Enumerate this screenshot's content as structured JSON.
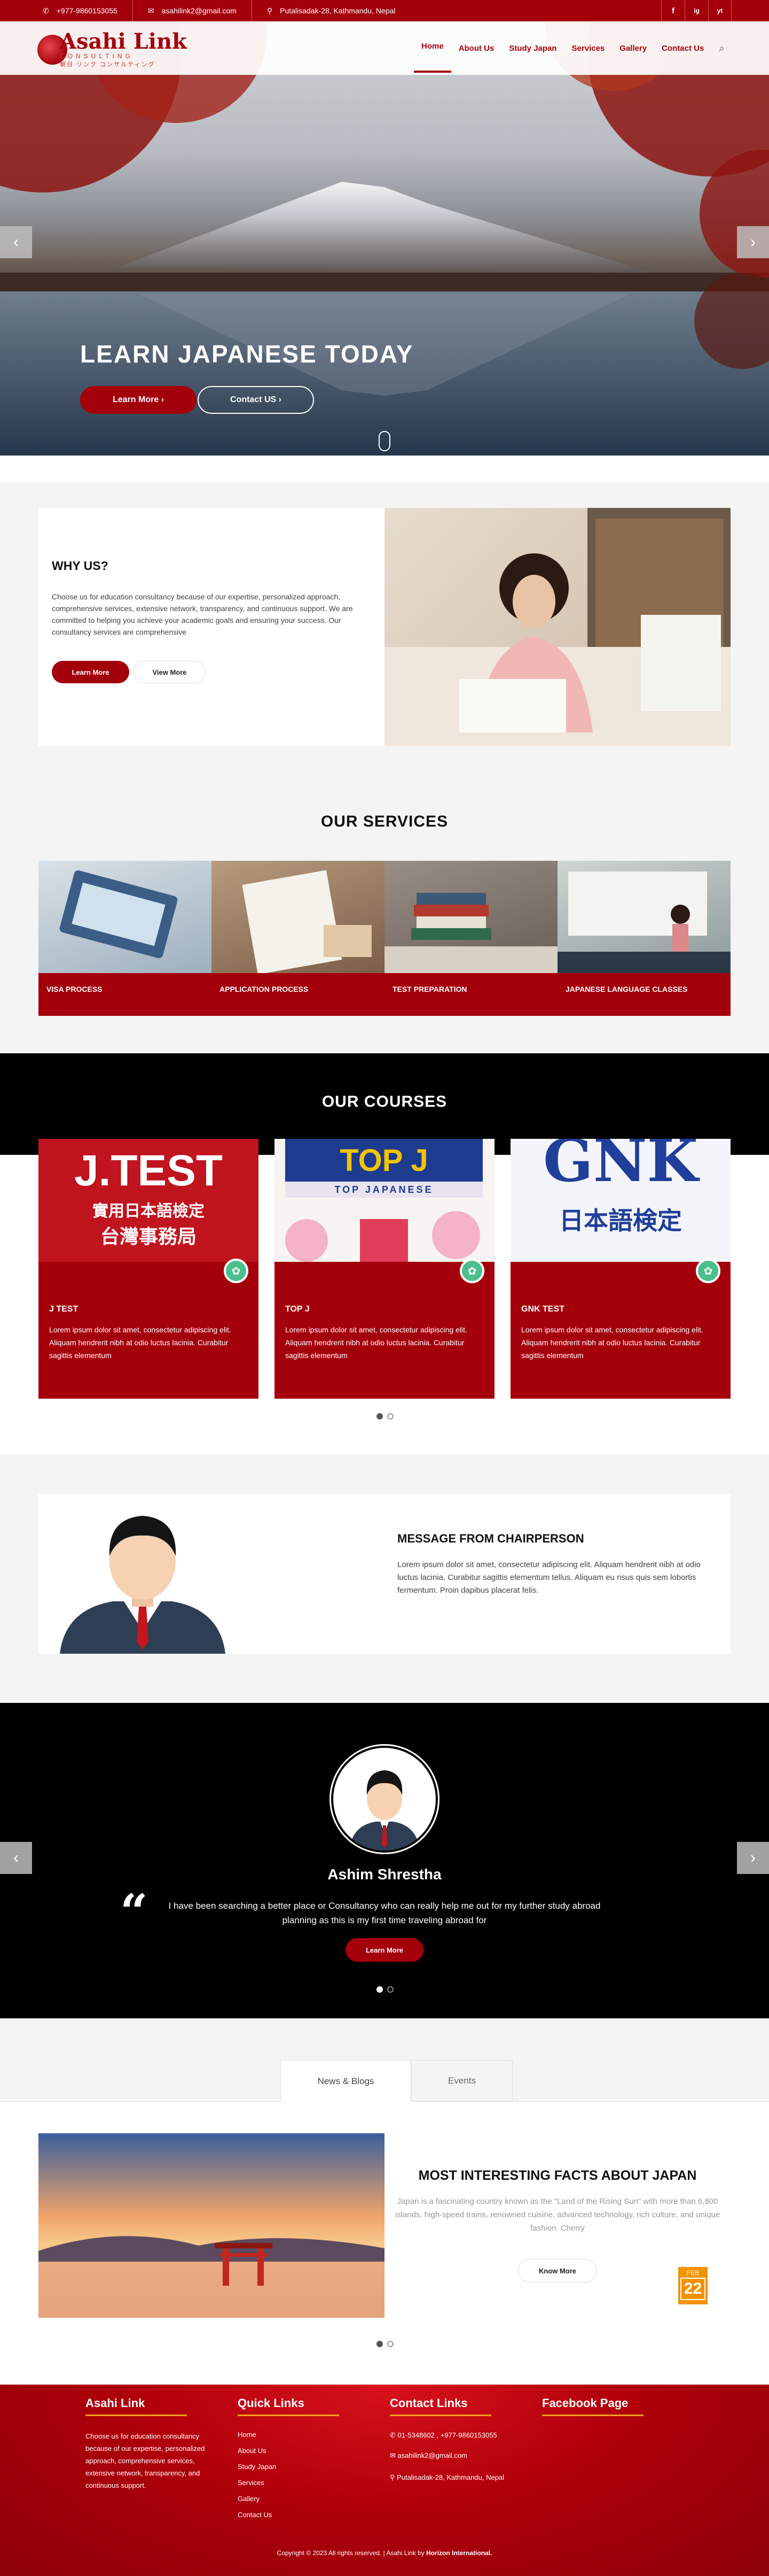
{
  "topbar": {
    "phone": "+977-9860153055",
    "email": "asahilink2@gmail.com",
    "address": "Putalisadak-28, Kathmandu, Nepal",
    "social": [
      "f",
      "ig",
      "yt"
    ]
  },
  "brand": {
    "name": "Asahi Link",
    "sub": "CONSULTING",
    "jp": "朝日 リンク コンサルティング"
  },
  "nav": [
    "Home",
    "About Us",
    "Study Japan",
    "Services",
    "Gallery",
    "Contact Us"
  ],
  "hero": {
    "title": "LEARN JAPANESE TODAY",
    "btn1": "Learn More ›",
    "btn2": "Contact US ›"
  },
  "why": {
    "title": "WHY US?",
    "text": "Choose us for education consultancy because of our expertise, personalized approach, comprehensive services, extensive network, transparency, and continuous support. We are committed to helping you achieve your academic goals and ensuring your success. Our consultancy services are comprehensive",
    "btn1": "Learn More",
    "btn2": "View More"
  },
  "services": {
    "title": "OUR SERVICES",
    "items": [
      "VISA PROCESS",
      "APPLICATION PROCESS",
      "TEST PREPARATION",
      "JAPANESE LANGUAGE CLASSES"
    ]
  },
  "courses": {
    "title": "OUR COURSES",
    "items": [
      {
        "name": "J TEST",
        "img": "J.TEST",
        "img2": "實用日本語檢定",
        "img3": "台灣事務局",
        "text": "Lorem ipsum dolor sit amet, consectetur adipiscing elit. Aliquam hendrerit nibh at odio luctus lacinia. Curabitur sagittis elementum"
      },
      {
        "name": "TOP J",
        "img": "TOP J",
        "img2": "TOP JAPANESE",
        "text": "Lorem ipsum dolor sit amet, consectetur adipiscing elit. Aliquam hendrerit nibh at odio luctus lacinia. Curabitur sagittis elementum"
      },
      {
        "name": "GNK TEST",
        "img": "GNK",
        "img2": "日本語検定",
        "text": "Lorem ipsum dolor sit amet, consectetur adipiscing elit. Aliquam hendrerit nibh at odio luctus lacinia. Curabitur sagittis elementum"
      }
    ]
  },
  "chair": {
    "title": "MESSAGE FROM CHAIRPERSON",
    "text": "Lorem ipsum dolor sit amet, consectetur adipiscing elit. Aliquam hendrerit nibh at odio luctus lacinia. Curabitur sagittis elementum tellus. Aliquam eu risus quis sem lobortis fermentum. Proin dapibus placerat felis."
  },
  "testimonial": {
    "name": "Ashim Shrestha",
    "quote": "I have been searching a better place or Consultancy who can really help me out for my further study abroad planning as this is my first time traveling abroad  for",
    "btn": "Learn More"
  },
  "news": {
    "tabs": [
      "News & Blogs",
      "Events"
    ],
    "title": "MOST INTERESTING FACTS ABOUT JAPAN",
    "text": "Japan is a fascinating country known as the \"Land of the Rising Sun\" with more than 6,800 islands, high-speed trains, renowned cuisine, advanced technology, rich culture, and unique fashion. Cherry",
    "btn": "Know More",
    "month": "FEB",
    "day": "22"
  },
  "footer": {
    "c1": {
      "title": "Asahi Link",
      "text": "Choose us for education consultancy because of our expertise, personalized approach, comprehensive services, extensive network, transparency, and continuous support."
    },
    "c2": {
      "title": "Quick Links",
      "links": [
        "Home",
        "About Us",
        "Study Japan",
        "Services",
        "Gallery",
        "Contact Us"
      ]
    },
    "c3": {
      "title": "Contact Links",
      "phone": "01-5348602 , +977-9860153055",
      "email": "asahilink2@gmail.com",
      "address": "Putalisadak-28, Kathmandu, Nepal"
    },
    "c4": {
      "title": "Facebook Page"
    },
    "copy": "Copyright © 2023 All rights reserved. | Asahi Link by ",
    "copy_b": "Horizon International."
  },
  "colors": {
    "brand": "#a4000c",
    "accent": "#f3a020"
  }
}
